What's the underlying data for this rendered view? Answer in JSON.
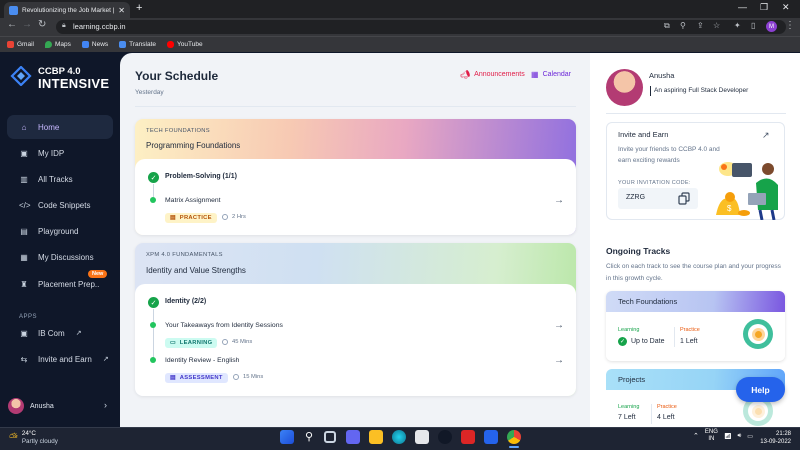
{
  "browser": {
    "tab_title": "Revolutionizing the Job Market |",
    "url": "learning.ccbp.in",
    "profile_initial": "M",
    "bookmarks": [
      "Gmail",
      "Maps",
      "News",
      "Translate",
      "YouTube"
    ]
  },
  "sidebar": {
    "logo_line1": "CCBP 4.0",
    "logo_line2": "INTENSIVE",
    "items": [
      {
        "label": "Home",
        "icon": "home-icon",
        "active": true
      },
      {
        "label": "My IDP",
        "icon": "idp-icon"
      },
      {
        "label": "All Tracks",
        "icon": "tracks-icon"
      },
      {
        "label": "Code Snippets",
        "icon": "code-icon"
      },
      {
        "label": "Playground",
        "icon": "playground-icon"
      },
      {
        "label": "My Discussions",
        "icon": "discussions-icon"
      },
      {
        "label": "Placement Prep..",
        "icon": "placement-icon"
      }
    ],
    "new_badge": "New",
    "apps_heading": "APPS",
    "apps": [
      {
        "label": "IB Com",
        "icon": "ibcom-icon"
      },
      {
        "label": "Invite and Earn",
        "icon": "invite-icon"
      }
    ],
    "user_name": "Anusha"
  },
  "schedule": {
    "title": "Your Schedule",
    "date": "Yesterday",
    "announcements": "Announcements",
    "calendar": "Calendar",
    "blocks": [
      {
        "category": "TECH FOUNDATIONS",
        "title": "Programming Foundations",
        "section": "Problem-Solving (1/1)",
        "items": [
          {
            "title": "Matrix Assignment",
            "tag": "PRACTICE",
            "duration": "2 Hrs"
          }
        ]
      },
      {
        "category": "XPM 4.0 FUNDAMENTALS",
        "title": "Identity and Value Strengths",
        "section": "Identity (2/2)",
        "items": [
          {
            "title": "Your Takeaways from Identity Sessions",
            "tag": "LEARNING",
            "duration": "45 Mins"
          },
          {
            "title": "Identity Review - English",
            "tag": "ASSESSMENT",
            "duration": "15 Mins"
          }
        ]
      }
    ]
  },
  "profile": {
    "name": "Anusha",
    "role": "An aspiring Full Stack Developer"
  },
  "invite": {
    "title": "Invite and Earn",
    "desc": "Invite your friends to CCBP 4.0 and earn exciting rewards",
    "code_label": "YOUR INVITATION CODE:",
    "code": "ZZRG"
  },
  "ongoing": {
    "title": "Ongoing Tracks",
    "desc": "Click on each track to see the course plan and your progress in this growth cycle.",
    "tracks": [
      {
        "name": "Tech Foundations",
        "learning_label": "Learning",
        "learning_value": "Up to Date",
        "practice_label": "Practice",
        "practice_value": "1 Left"
      },
      {
        "name": "Projects",
        "learning_label": "Learning",
        "learning_value": "7 Left",
        "practice_label": "Practice",
        "practice_value": "4 Left"
      }
    ]
  },
  "help": "Help",
  "taskbar": {
    "temp": "24°C",
    "weather": "Partly cloudy",
    "lang1": "ENG",
    "lang2": "IN",
    "time": "21:28",
    "date": "13-09-2022"
  }
}
